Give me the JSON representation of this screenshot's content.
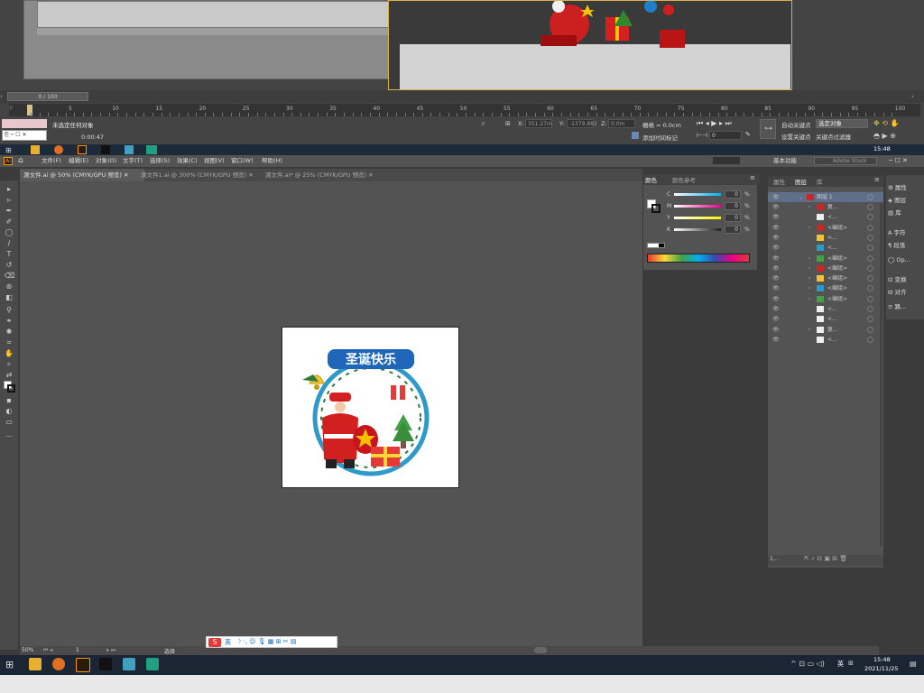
{
  "max": {
    "frame_counter": "0 / 100",
    "timeline_ticks": [
      "5",
      "10",
      "15",
      "20",
      "25",
      "30",
      "35",
      "40",
      "45",
      "50",
      "55",
      "60",
      "65",
      "70",
      "75",
      "80",
      "85",
      "90",
      "95",
      "100"
    ],
    "timeline_start": "15",
    "status_selected": "未选定任何对象",
    "time_display": "0:00:47",
    "coord_x_label": "X:",
    "coord_x": "351.27m",
    "coord_y_label": "Y:",
    "coord_y": "-1379.882",
    "coord_z_label": "Z:",
    "coord_z": "0.0m",
    "grid_label": "栅格 = 0.0cm",
    "add_time_tag": "添加时间标记",
    "auto_key": "自动关键点",
    "selected_obj": "选定对象",
    "set_key": "设置关键点",
    "key_filter": "关键点过滤器",
    "frame_field": "0",
    "clock": "15:48"
  },
  "ai": {
    "logo": "Ai",
    "menus": [
      "文件(F)",
      "编辑(E)",
      "对象(O)",
      "文字(T)",
      "选择(S)",
      "效果(C)",
      "视图(V)",
      "窗口(W)",
      "帮助(H)"
    ],
    "workspace": "基本功能",
    "search_placeholder": "Adobe Stock",
    "tabs": [
      "源文件.ai @ 50% (CMYK/GPU 预览)",
      "源文件1.ai @ 300% (CMYK/GPU 预览)",
      "源文件.ai* @ 25% (CMYK/GPU 预览)"
    ],
    "zoom": "50%",
    "artboard_num": "1",
    "status_text": "选择",
    "artwork_title": "圣诞快乐"
  },
  "color_panel": {
    "tab_color": "颜色",
    "tab_guide": "颜色参考",
    "channels": [
      {
        "label": "C",
        "value": "0",
        "color": "#00aeef"
      },
      {
        "label": "M",
        "value": "0",
        "color": "#ec008c"
      },
      {
        "label": "Y",
        "value": "0",
        "color": "#fff200"
      },
      {
        "label": "K",
        "value": "0",
        "color": "#231f20"
      }
    ],
    "percent": "%"
  },
  "layers_panel": {
    "tabs": [
      "属性",
      "图层",
      "库"
    ],
    "layer_name": "图层 1",
    "rows": [
      "复...",
      "<...",
      "<编组>",
      "<...",
      "<...",
      "<编组>",
      "<编组>",
      "<编组>",
      "<编组>",
      "<编组>",
      "<...",
      "<...",
      "复...",
      "<..."
    ],
    "footer": "1..."
  },
  "dock": {
    "items": [
      "属性",
      "图层",
      "库",
      "字符",
      "段落",
      "Op...",
      "变换",
      "对齐",
      "路..."
    ]
  },
  "ime": {
    "label": "英"
  },
  "taskbar": {
    "time": "15:48",
    "date": "2021/11/25",
    "lang": "英"
  }
}
